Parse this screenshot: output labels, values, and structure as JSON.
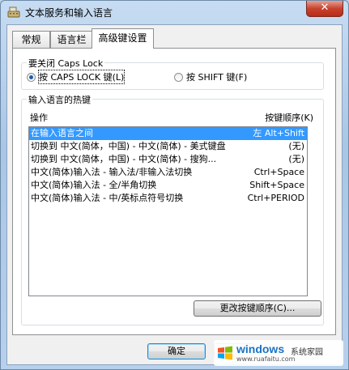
{
  "window": {
    "title": "文本服务和输入语言",
    "close_glyph": "✕"
  },
  "tabs": [
    {
      "label": "常规",
      "active": false
    },
    {
      "label": "语言栏",
      "active": false
    },
    {
      "label": "高级键设置",
      "active": true
    }
  ],
  "caps_group": {
    "title": "要关闭 Caps Lock",
    "option_caps": "按 CAPS LOCK 键(L)",
    "option_shift": "按 SHIFT 键(F)",
    "selected": "caps"
  },
  "hotkeys_group": {
    "title": "输入语言的热键",
    "col_action": "操作",
    "col_key": "按键顺序(K)",
    "rows": [
      {
        "action": "在输入语言之间",
        "key": "左 Alt+Shift",
        "selected": true
      },
      {
        "action": "切换到 中文(简体，中国) - 中文(简体) - 美式键盘",
        "key": "(无)",
        "selected": false
      },
      {
        "action": "切换到 中文(简体，中国) - 中文(简体) - 搜狗...",
        "key": "(无)",
        "selected": false
      },
      {
        "action": "中文(简体)输入法 - 输入法/非输入法切换",
        "key": "Ctrl+Space",
        "selected": false
      },
      {
        "action": "中文(简体)输入法 - 全/半角切换",
        "key": "Shift+Space",
        "selected": false
      },
      {
        "action": "中文(简体)输入法 - 中/英标点符号切换",
        "key": "Ctrl+PERIOD",
        "selected": false
      }
    ],
    "change_button": "更改按键顺序(C)..."
  },
  "buttons": {
    "ok": "确定"
  },
  "watermark": {
    "brand": "windows",
    "sub": "系统家园",
    "url": "www.ruafaitu.com"
  },
  "colors": {
    "selection": "#3399ff",
    "radio_dot": "#1d5fa9",
    "close": "#c7432f"
  }
}
